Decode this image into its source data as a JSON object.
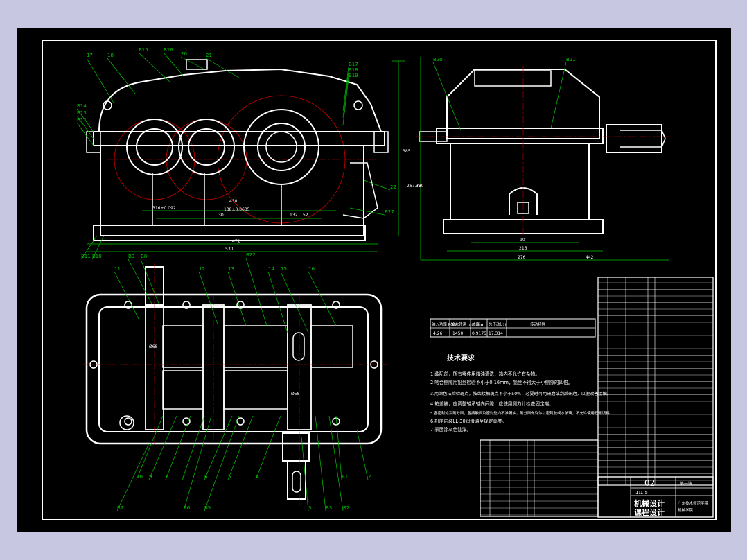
{
  "drawing": {
    "front_view_labels": [
      "17",
      "18",
      "B15",
      "B16",
      "20",
      "21",
      "B17",
      "B18",
      "B19",
      "B14",
      "B13",
      "B12",
      "B11",
      "B10",
      "22",
      "B27"
    ],
    "front_dims": [
      "316±0.092",
      "430",
      "138±0.0635",
      "132",
      "30",
      "52",
      "472",
      "530",
      "385",
      "267.77"
    ],
    "side_view_labels": [
      "B20",
      "B21"
    ],
    "side_dims": [
      "90",
      "216",
      "276",
      "442",
      "380"
    ],
    "top_view_labels": [
      "11",
      "B9",
      "B8",
      "12",
      "13",
      "B22",
      "14",
      "15",
      "16",
      "10",
      "B7",
      "9",
      "8",
      "7",
      "B6",
      "6",
      "B5",
      "5",
      "4",
      "3",
      "B3",
      "B2",
      "B1",
      "2",
      "1"
    ],
    "top_dims": [
      "Ø58",
      "Ø68"
    ],
    "tech_params": {
      "headers": [
        "输入功率 P(kW)",
        "输入转速 n(r/min)",
        "效率 η",
        "总传动比 i",
        "传动特性"
      ],
      "values": [
        "4.26",
        "1450",
        "0.9175",
        "17.314"
      ]
    },
    "tech_req_title": "技术要求",
    "tech_requirements": [
      "1.装配前，所有零件用煤油清洗，箱内不允许有杂物。",
      "2.啮合侧隙用铅丝检验不小于0.16mm，铅丝不得大于小侧隙的四倍。",
      "3.用涂色法检验斑点，按齿接触斑点不小于50%，必要时可用研磨或刮后研磨，以便改善接触。",
      "4.箱盖被，应调整轴承轴向间隙，应使用测力计检查固定端。",
      "5.各密封处及剖分面，各接触面及密封处均不准漏油，剖分面允许涂以密封胶或水玻璃，不允许使用任何填料。",
      "6.机座内装LL-30润滑油至规定高度。",
      "7.表面涂灰色油漆。"
    ],
    "title_block": {
      "drawing_no": "02",
      "scale": "1:1.5",
      "sheet": "第一张",
      "title_line1": "机械设计",
      "title_line2": "课程设计",
      "school_line": "广东技术师范学院",
      "school_sub": "机械学院"
    }
  },
  "colors": {
    "background": "#000000",
    "outer": "#c7c7e2",
    "outline": "#ffffff",
    "leader": "#00c800",
    "centerline": "#d00000"
  }
}
